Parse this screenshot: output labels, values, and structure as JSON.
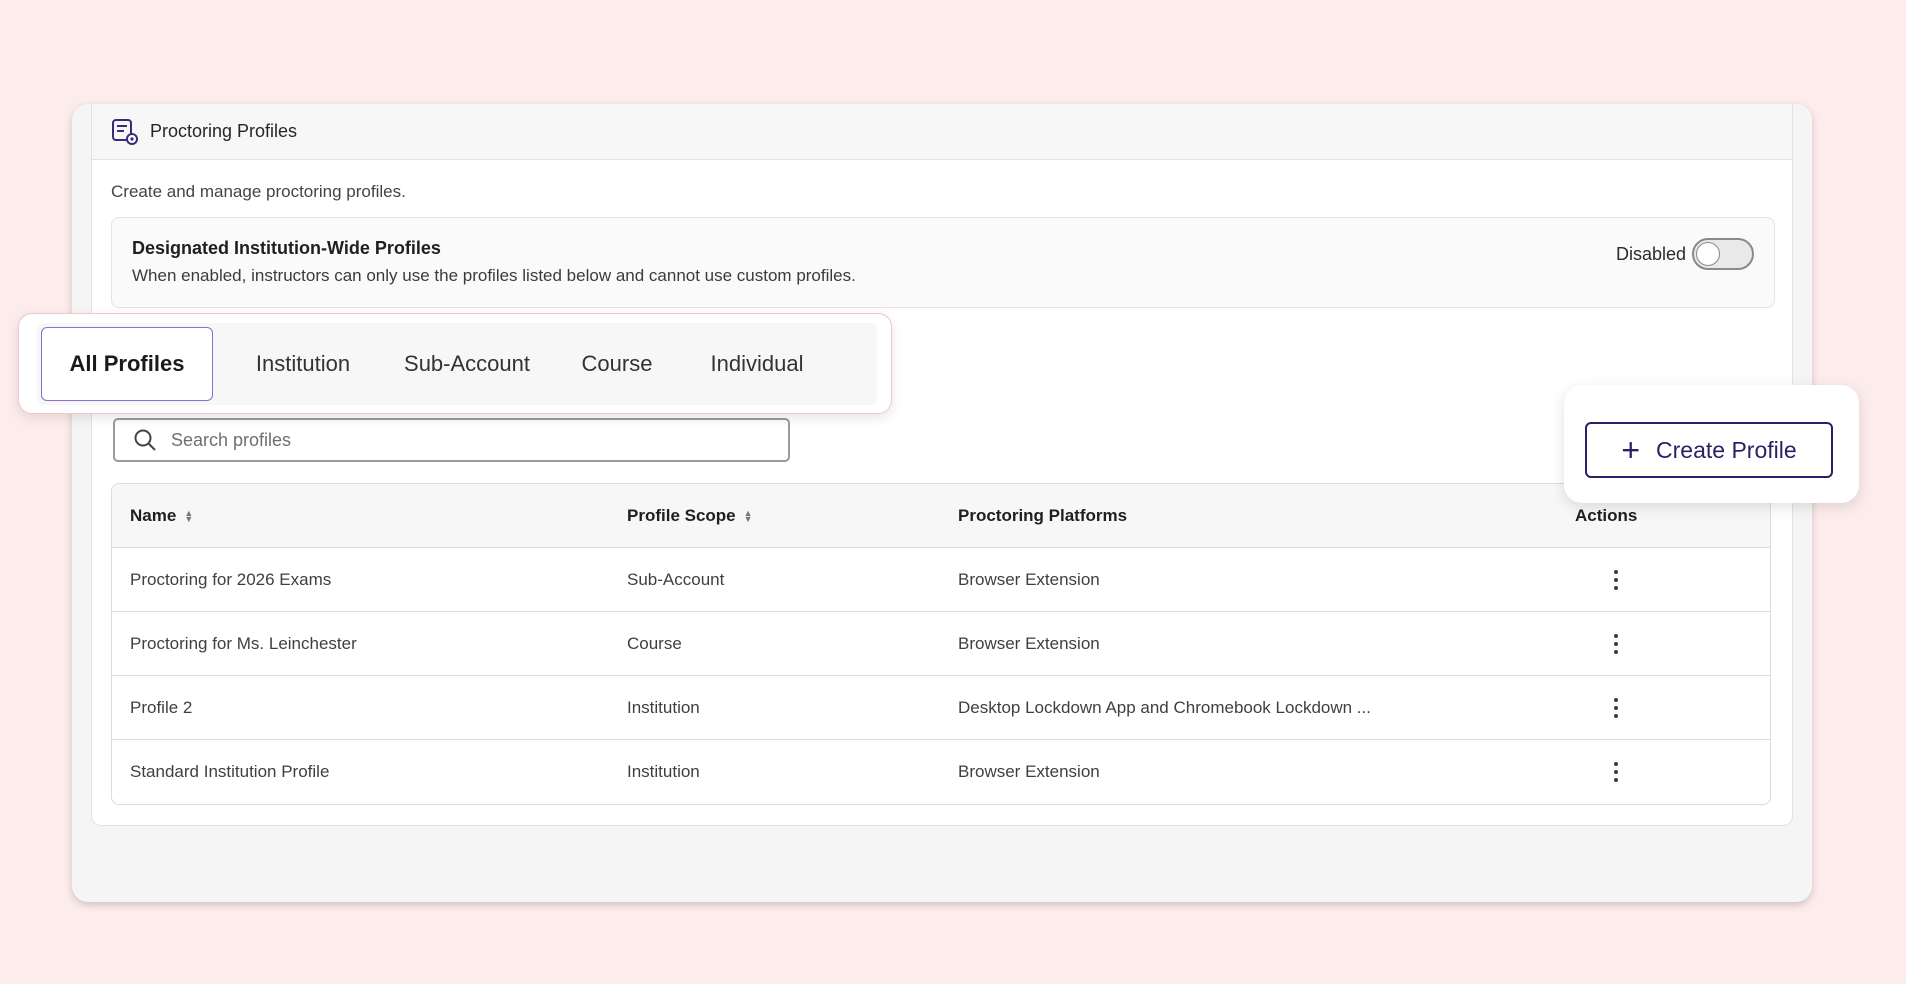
{
  "header": {
    "title": "Proctoring Profiles",
    "icon": "document-settings-icon"
  },
  "description": "Create and manage proctoring profiles.",
  "designated": {
    "title": "Designated Institution-Wide Profiles",
    "subtitle": "When enabled, instructors can only use the profiles listed below and cannot use custom profiles.",
    "toggle_label": "Disabled",
    "toggle_on": false
  },
  "tabs": [
    {
      "label": "All Profiles",
      "active": true
    },
    {
      "label": "Institution",
      "active": false
    },
    {
      "label": "Sub-Account",
      "active": false
    },
    {
      "label": "Course",
      "active": false
    },
    {
      "label": "Individual",
      "active": false
    }
  ],
  "search": {
    "placeholder": "Search profiles",
    "value": ""
  },
  "create_button": {
    "label": "Create Profile",
    "icon": "plus-icon"
  },
  "table": {
    "headers": {
      "name": "Name",
      "scope": "Profile Scope",
      "platforms": "Proctoring Platforms",
      "actions": "Actions"
    },
    "rows": [
      {
        "name": "Proctoring for 2026 Exams",
        "scope": "Sub-Account",
        "platforms": "Browser Extension"
      },
      {
        "name": "Proctoring for Ms. Leinchester",
        "scope": "Course",
        "platforms": "Browser Extension"
      },
      {
        "name": "Profile 2",
        "scope": "Institution",
        "platforms": "Desktop Lockdown App and Chromebook Lockdown ..."
      },
      {
        "name": "Standard Institution Profile",
        "scope": "Institution",
        "platforms": "Browser Extension"
      }
    ]
  },
  "colors": {
    "background": "#fdecec",
    "accent": "#2d1f66",
    "active_tab_border": "#8a6dd9"
  }
}
